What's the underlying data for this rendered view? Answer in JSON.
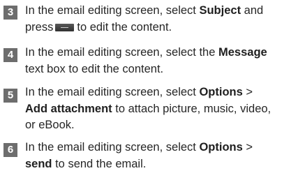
{
  "steps": [
    {
      "number": "3",
      "lines": [
        {
          "pre": "In the email editing screen, select ",
          "bold": "Subject",
          "post": " and"
        },
        {
          "pre": "press",
          "key_icon": "menu-key-icon",
          "post": "to edit the content."
        }
      ]
    },
    {
      "number": "4",
      "lines": [
        {
          "pre": "In the email editing screen, select the ",
          "bold": "Message"
        },
        {
          "pre": "text box to edit the content."
        }
      ]
    },
    {
      "number": "5",
      "lines": [
        {
          "pre": "In the email editing screen, select ",
          "bold": "Options",
          "post": " >"
        },
        {
          "bold": "Add attachment",
          "post": " to attach picture, music, video,"
        },
        {
          "pre": "or eBook."
        }
      ]
    },
    {
      "number": "6",
      "lines": [
        {
          "pre": "In the email editing screen, select ",
          "bold": "Options",
          "post": " >"
        },
        {
          "bold": "send",
          "post": " to send the email."
        }
      ]
    }
  ]
}
